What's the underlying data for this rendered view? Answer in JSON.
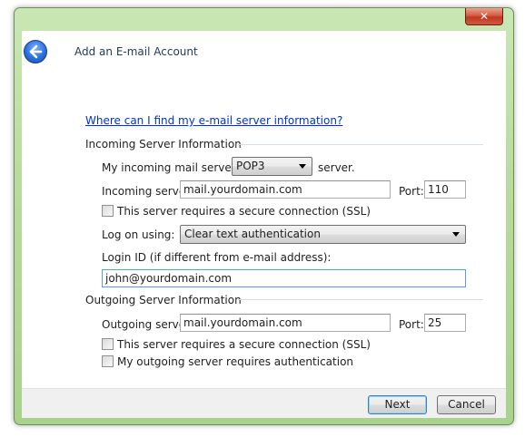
{
  "window": {
    "title": "Add an E-mail Account",
    "close_glyph": "✕"
  },
  "help_link": "Where can I find my e-mail server information?",
  "incoming": {
    "group_label": "Incoming Server Information",
    "server_type_prefix": "My incoming mail server is a",
    "server_type_value": "POP3",
    "server_type_suffix": "server.",
    "server_label": "Incoming server:",
    "server_value": "mail.yourdomain.com",
    "port_label": "Port:",
    "port_value": "110",
    "ssl_label": "This server requires a secure connection (SSL)",
    "ssl_checked": false,
    "logon_label": "Log on using:",
    "logon_value": "Clear text authentication",
    "login_id_label": "Login ID (if different from e-mail address):",
    "login_id_value": "john@yourdomain.com"
  },
  "outgoing": {
    "group_label": "Outgoing Server Information",
    "server_label": "Outgoing server:",
    "server_value": "mail.yourdomain.com",
    "port_label": "Port:",
    "port_value": "25",
    "ssl_label": "This server requires a secure connection (SSL)",
    "ssl_checked": false,
    "auth_label": "My outgoing server requires authentication",
    "auth_checked": false
  },
  "buttons": {
    "next": "Next",
    "cancel": "Cancel"
  },
  "icons": {
    "back": "back-arrow-icon",
    "dropdown": "chevron-down-icon"
  },
  "colors": {
    "frame_accent": "#b7db9b",
    "link": "#0033cc",
    "close_button": "#c2371f"
  }
}
